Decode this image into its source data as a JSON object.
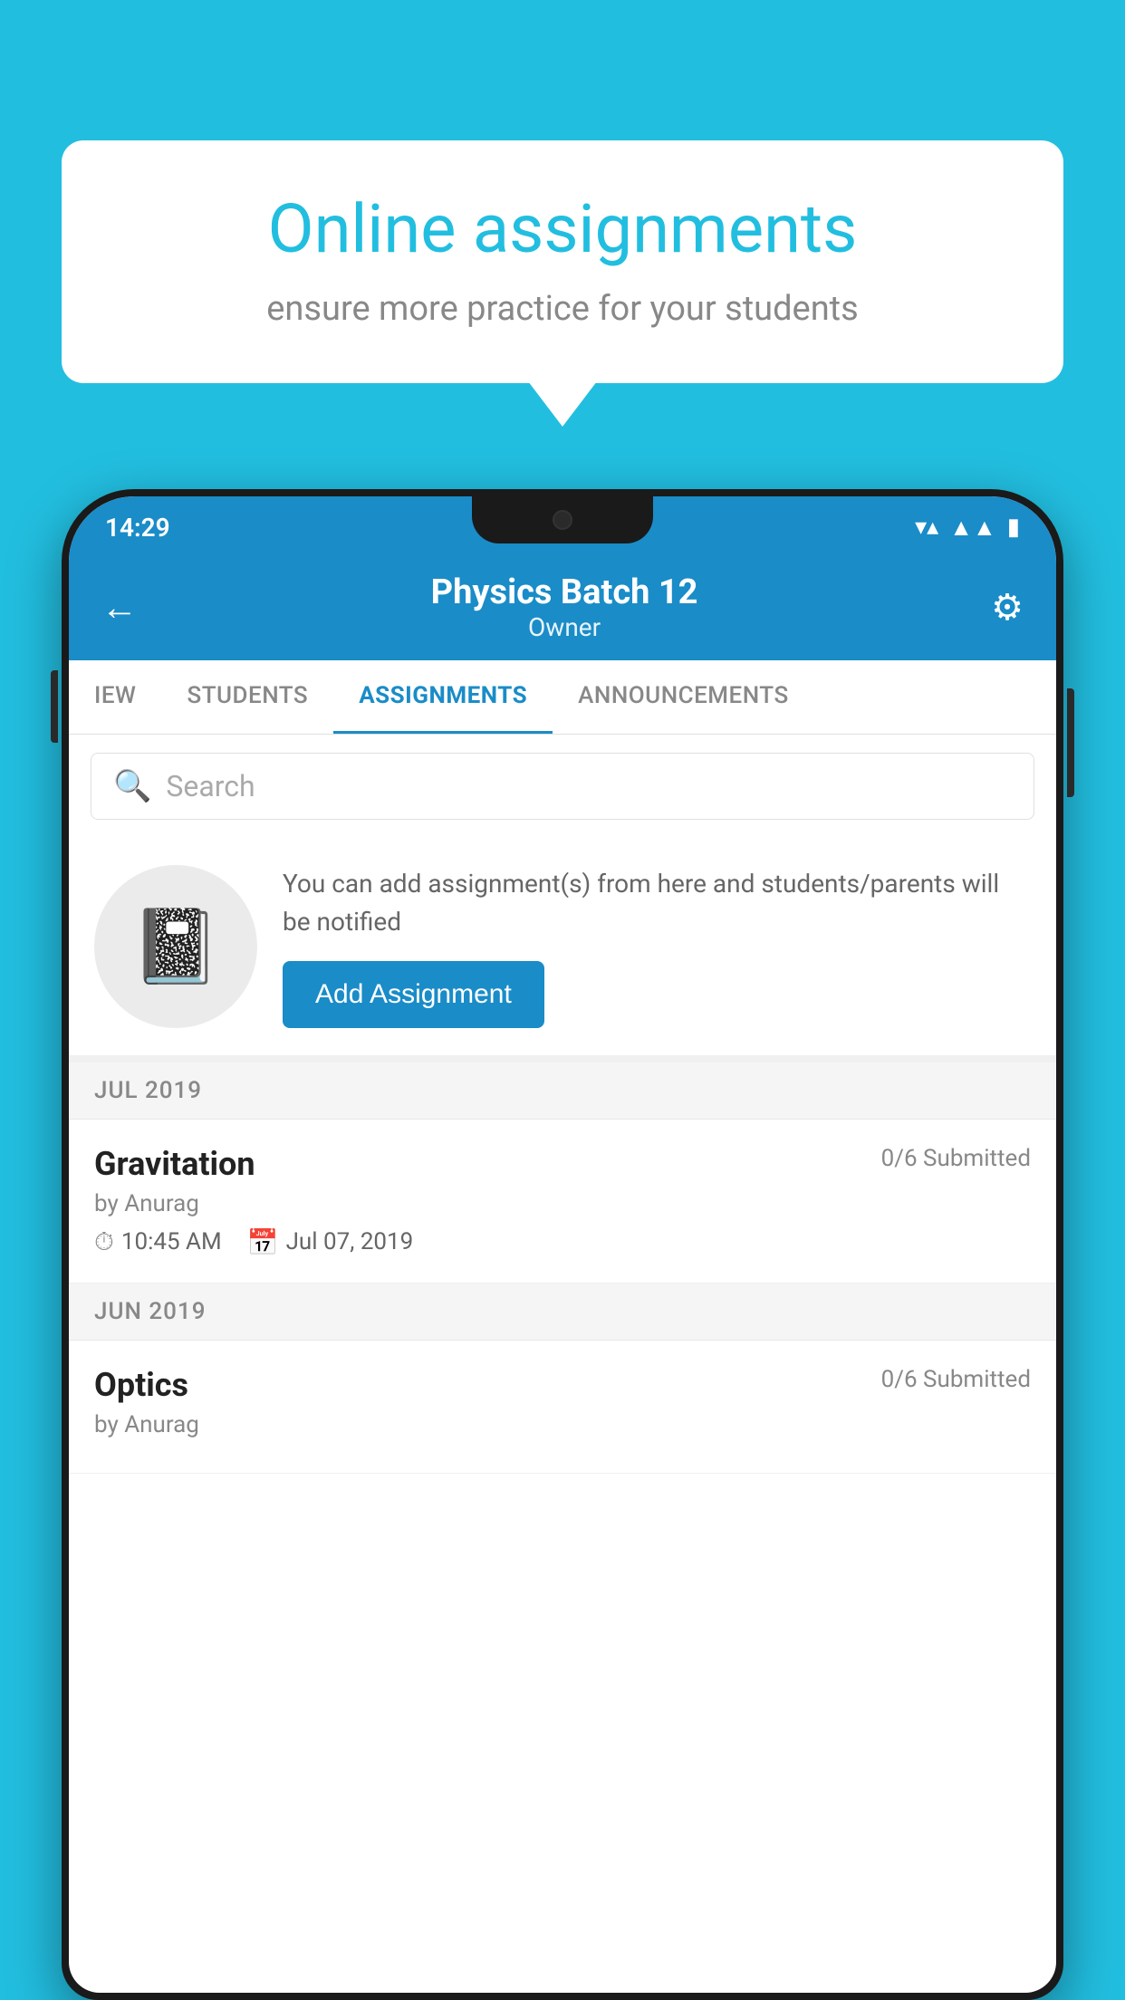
{
  "background_color": "#22BEE0",
  "bubble": {
    "title": "Online assignments",
    "subtitle": "ensure more practice for your students"
  },
  "status_bar": {
    "time": "14:29",
    "wifi_icon": "▾",
    "signal_icon": "▲",
    "battery_icon": "▮"
  },
  "header": {
    "title": "Physics Batch 12",
    "subtitle": "Owner",
    "back_label": "←",
    "settings_label": "⚙"
  },
  "tabs": [
    {
      "label": "IEW",
      "active": false
    },
    {
      "label": "STUDENTS",
      "active": false
    },
    {
      "label": "ASSIGNMENTS",
      "active": true
    },
    {
      "label": "ANNOUNCEMENTS",
      "active": false
    }
  ],
  "search": {
    "placeholder": "Search"
  },
  "promo": {
    "text": "You can add assignment(s) from here and students/parents will be notified",
    "button_label": "Add Assignment"
  },
  "month_sections": [
    {
      "label": "JUL 2019",
      "assignments": [
        {
          "title": "Gravitation",
          "submitted": "0/6 Submitted",
          "by": "by Anurag",
          "time": "10:45 AM",
          "date": "Jul 07, 2019"
        }
      ]
    },
    {
      "label": "JUN 2019",
      "assignments": [
        {
          "title": "Optics",
          "submitted": "0/6 Submitted",
          "by": "by Anurag",
          "time": "",
          "date": ""
        }
      ]
    }
  ]
}
